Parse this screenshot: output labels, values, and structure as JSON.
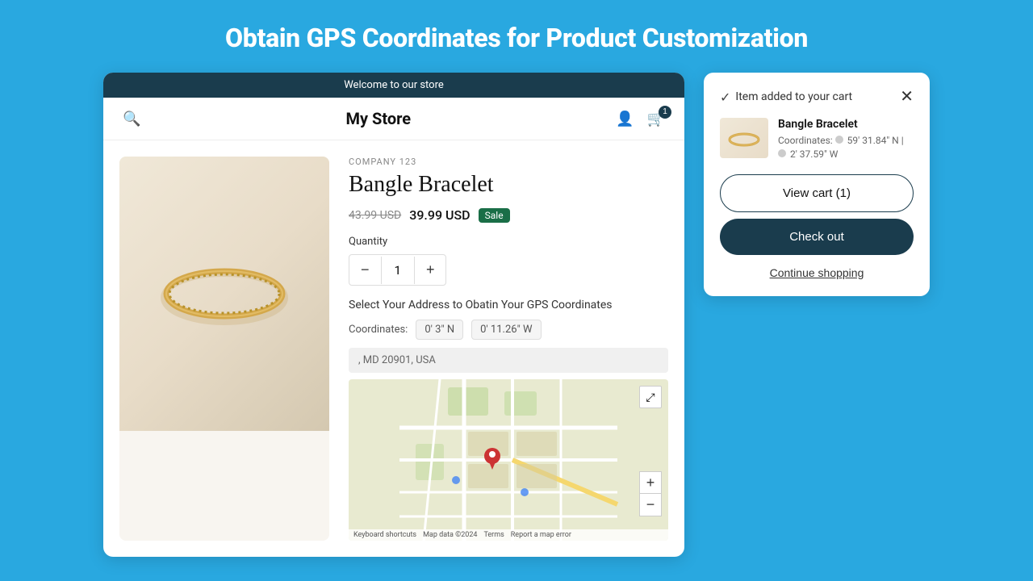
{
  "page": {
    "title": "Obtain GPS Coordinates for Product Customization",
    "background_color": "#29a8e0"
  },
  "store": {
    "banner": "Welcome to our store",
    "name": "My Store",
    "company": "COMPANY 123",
    "product_title": "Bangle Bracelet",
    "price_original": "43.99 USD",
    "price_sale": "39.99 USD",
    "sale_badge": "Sale",
    "quantity_label": "Quantity",
    "quantity_value": "1",
    "address_section_label": "Select Your Address to Obatin Your GPS Coordinates",
    "coordinates_label": "Coordinates:",
    "coord_lat": "0' 3\" N",
    "coord_lng": "0' 11.26\" W",
    "address_value": ", MD 20901, USA",
    "map_footer_keyboard": "Keyboard shortcuts",
    "map_footer_data": "Map data ©2024",
    "map_footer_terms": "Terms",
    "map_footer_report": "Report a map error"
  },
  "cart_popup": {
    "added_message": "Item added to your cart",
    "item_name": "Bangle Bracelet",
    "item_coords_label": "Coordinates:",
    "item_coord_lat": "59' 31.84\" N |",
    "item_coord_lng": "2' 37.59\" W",
    "view_cart_label": "View cart (1)",
    "checkout_label": "Check out",
    "continue_label": "Continue shopping"
  },
  "icons": {
    "search": "🔍",
    "user": "👤",
    "cart": "🛒",
    "close": "✕",
    "check": "✓",
    "expand": "⤢",
    "zoom_in": "+",
    "zoom_out": "−",
    "qty_minus": "−",
    "qty_plus": "+"
  }
}
